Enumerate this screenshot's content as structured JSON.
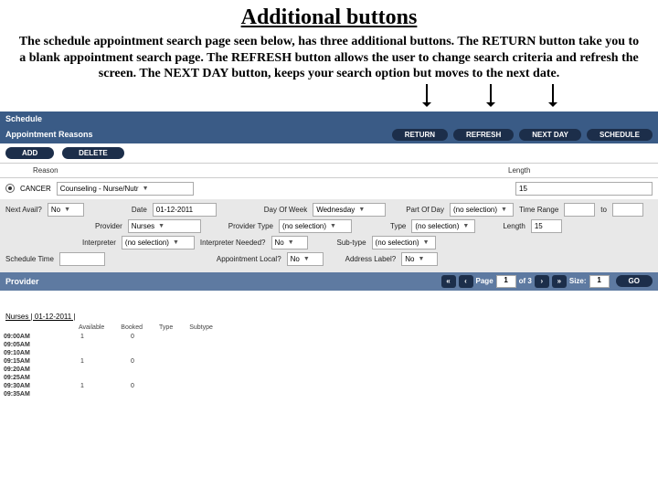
{
  "heading": "Additional buttons",
  "intro": "The schedule appointment search page seen below, has three additional buttons. The RETURN button take you to a blank appointment search page. The REFRESH button allows the user to change search criteria and refresh the screen. The NEXT DAY button, keeps your search option but moves to the next date.",
  "bars": {
    "schedule": "Schedule",
    "appt_reasons": "Appointment Reasons",
    "provider": "Provider"
  },
  "top_pills": {
    "return": "RETURN",
    "refresh": "REFRESH",
    "nextday": "NEXT DAY",
    "schedule": "SCHEDULE"
  },
  "action_pills": {
    "add": "ADD",
    "delete": "DELETE"
  },
  "reason_cols": {
    "reason": "Reason",
    "length": "Length"
  },
  "reason_row": {
    "code": "CANCER",
    "desc": "Counseling - Nurse/Nutr",
    "length": "15"
  },
  "filters": {
    "next_avail_lbl": "Next Avail?",
    "next_avail_val": "No",
    "date_lbl": "Date",
    "date_val": "01-12-2011",
    "dow_lbl": "Day Of Week",
    "dow_val": "Wednesday",
    "pod_lbl": "Part Of Day",
    "pod_val": "(no selection)",
    "tr_lbl": "Time Range",
    "tr_to": "to",
    "prov_lbl": "Provider",
    "prov_val": "Nurses",
    "ptype_lbl": "Provider Type",
    "ptype_val": "(no selection)",
    "type_lbl": "Type",
    "type_val": "(no selection)",
    "len_lbl": "Length",
    "len_val": "15",
    "interp_lbl": "Interpreter",
    "interp_val": "(no selection)",
    "interpneed_lbl": "Interpreter Needed?",
    "interpneed_val": "No",
    "subtype_lbl": "Sub-type",
    "subtype_val": "(no selection)",
    "apptloc_lbl": "Appointment Local?",
    "apptloc_val": "No",
    "addrlbl_lbl": "Address Label?",
    "addrlbl_val": "No",
    "sched_time_lbl": "Schedule Time"
  },
  "pager": {
    "page_lbl": "Page",
    "page_val": "1",
    "of": "of 3",
    "size_lbl": "Size:",
    "size_val": "1",
    "go": "GO"
  },
  "schedule_header": "Nurses | 01-12-2011 |",
  "sched_cols": {
    "avail": "Available",
    "booked": "Booked",
    "type": "Type",
    "subtype": "Subtype"
  },
  "slots": [
    {
      "t": "09:00AM",
      "a": "1",
      "b": "0"
    },
    {
      "t": "09:05AM",
      "a": "",
      "b": ""
    },
    {
      "t": "09:10AM",
      "a": "",
      "b": ""
    },
    {
      "t": "09:15AM",
      "a": "1",
      "b": "0"
    },
    {
      "t": "09:20AM",
      "a": "",
      "b": ""
    },
    {
      "t": "09:25AM",
      "a": "",
      "b": ""
    },
    {
      "t": "09:30AM",
      "a": "1",
      "b": "0"
    },
    {
      "t": "09:35AM",
      "a": "",
      "b": ""
    }
  ]
}
